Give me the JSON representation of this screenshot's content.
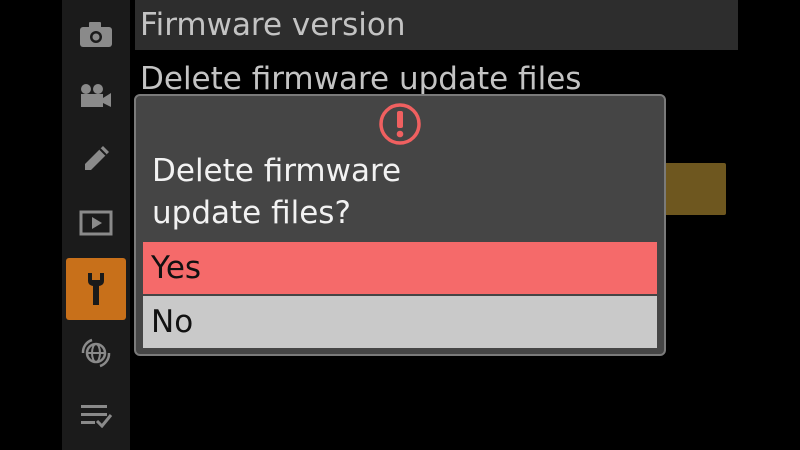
{
  "menu": {
    "items": [
      {
        "label": "Firmware version"
      },
      {
        "label": "Delete firmware update files"
      }
    ]
  },
  "sidebar": {
    "icons": [
      {
        "name": "photo-shooting-menu-icon"
      },
      {
        "name": "movie-shooting-menu-icon"
      },
      {
        "name": "custom-settings-pencil-icon"
      },
      {
        "name": "playback-menu-icon"
      },
      {
        "name": "setup-menu-wrench-icon",
        "active": true
      },
      {
        "name": "network-menu-icon"
      },
      {
        "name": "my-menu-icon"
      }
    ]
  },
  "dialog": {
    "icon": "warning-icon",
    "message": "Delete firmware update files?",
    "options": [
      {
        "label": "Yes",
        "selected": true
      },
      {
        "label": "No",
        "selected": false
      }
    ]
  },
  "colors": {
    "accent_orange": "#c8701a",
    "selected_option": "#f56a6a",
    "unselected_option": "#c9c9c9",
    "warning": "#f06060",
    "side_button": "#6e571f"
  }
}
